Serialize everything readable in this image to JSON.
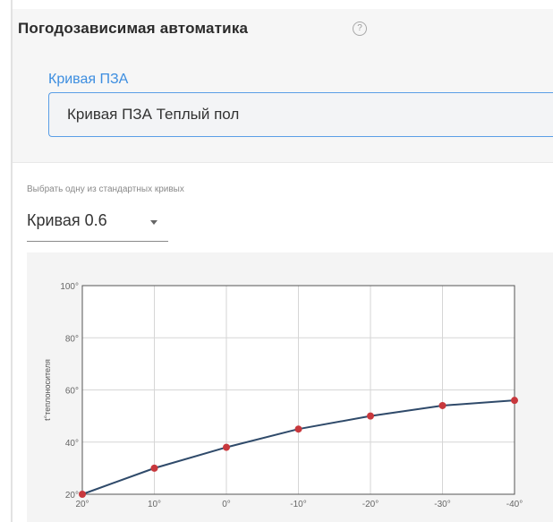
{
  "header": {
    "title": "Погодозависимая автоматика",
    "help_icon": "help-circle-icon",
    "help_glyph": "?"
  },
  "curve_field": {
    "label": "Кривая ПЗА",
    "value": "Кривая ПЗА Теплый пол"
  },
  "presets": {
    "hint": "Выбрать одну из стандартных кривых",
    "selected": "Кривая 0.6",
    "caret_icon": "caret-down-icon"
  },
  "colors": {
    "accent": "#3d8ee0",
    "line": "#2f4a6a",
    "point": "#c8383d",
    "grid": "#d6d6d6"
  },
  "chart_data": {
    "type": "line",
    "x": [
      "20°",
      "10°",
      "0°",
      "-10°",
      "-20°",
      "-30°",
      "-40°"
    ],
    "series": [
      {
        "values": [
          20,
          30,
          38,
          45,
          50,
          54,
          56
        ]
      }
    ],
    "y_ticks": [
      "20°",
      "40°",
      "60°",
      "80°",
      "100°"
    ],
    "ylim": [
      20,
      100
    ],
    "ylabel": "t°теплоносителя",
    "grid": true
  }
}
